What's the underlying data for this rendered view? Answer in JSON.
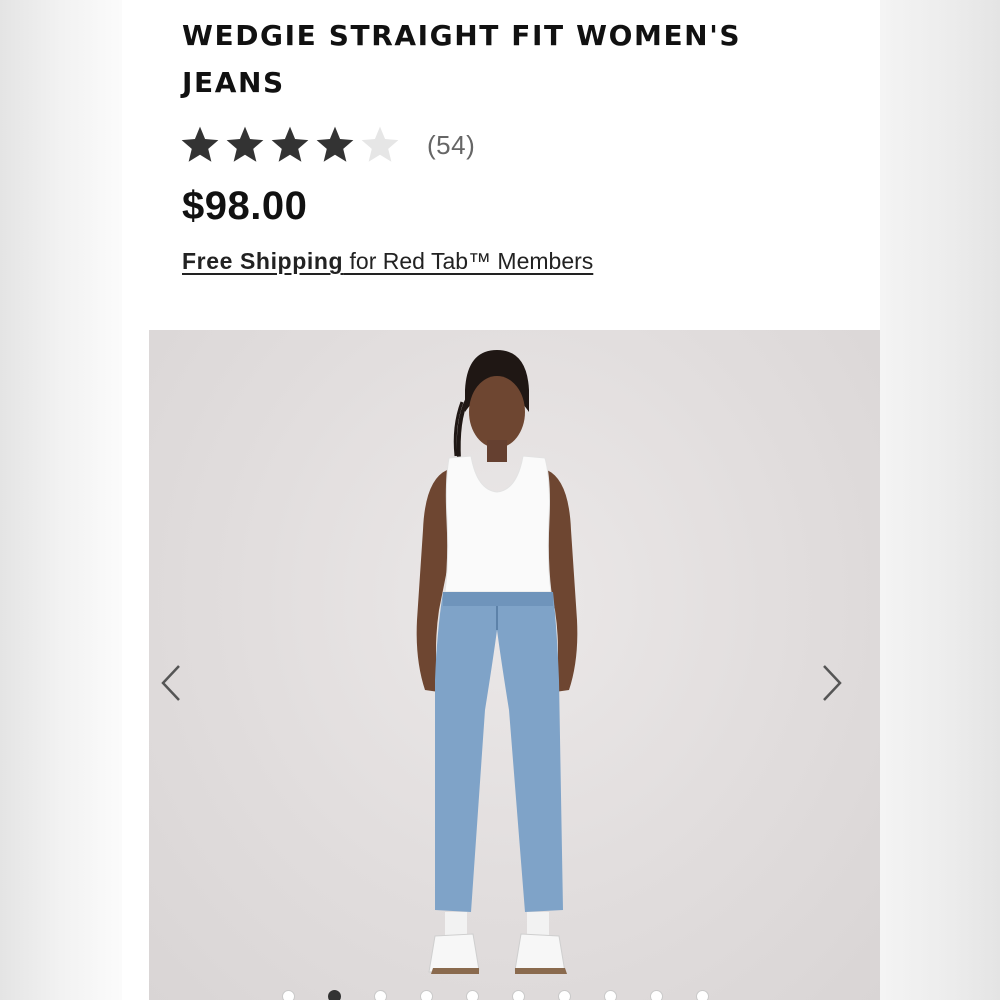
{
  "product": {
    "title": "WEDGIE STRAIGHT FIT WOMEN'S JEANS",
    "rating": {
      "value": 4,
      "max": 5,
      "count_label": "(54)"
    },
    "price": "$98.00",
    "shipping": {
      "strong": "Free Shipping",
      "rest": " for Red Tab™ Members"
    }
  },
  "carousel": {
    "image_icon": "product-photo-model-icon",
    "prev_icon": "chevron-left-icon",
    "next_icon": "chevron-right-icon",
    "slide_count": 10,
    "active_index": 1
  },
  "colors": {
    "text": "#111111",
    "star_filled": "#333333",
    "star_empty": "#e6e6e6",
    "denim": "#7fa3c8"
  }
}
